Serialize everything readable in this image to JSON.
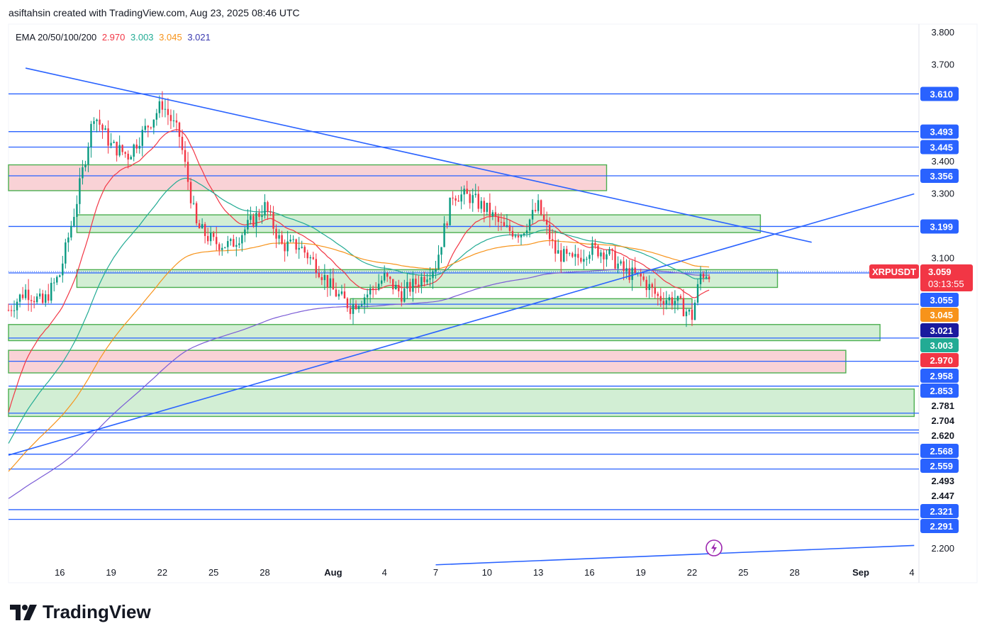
{
  "header": {
    "text": "asiftahsin created with TradingView.com, Aug 23, 2025 08:46 UTC"
  },
  "legend": {
    "label": "EMA 20/50/100/200",
    "values": [
      {
        "text": "2.970",
        "color": "#f23645"
      },
      {
        "text": "3.003",
        "color": "#22ab94"
      },
      {
        "text": "3.045",
        "color": "#f7931a"
      },
      {
        "text": "3.021",
        "color": "#3a3ab0"
      }
    ]
  },
  "symbol_tag": {
    "symbol": "XRPUSDT",
    "price": "3.059",
    "countdown": "03:13:55",
    "color": "#f23645"
  },
  "logo": {
    "text": "TradingView"
  },
  "colors": {
    "up": "#089981",
    "down": "#f23645",
    "level": "#2962ff",
    "supply": "#f8cdd2",
    "demand": "#cdeccf"
  },
  "chart_data": {
    "type": "candlestick",
    "y_range": [
      2.15,
      3.85
    ],
    "y_ticks": [
      {
        "value": 3.8,
        "label": "3.800"
      },
      {
        "value": 3.7,
        "label": "3.700"
      },
      {
        "value": 3.4,
        "label": "3.400"
      },
      {
        "value": 3.3,
        "label": "3.300"
      },
      {
        "value": 3.1,
        "label": "3.100"
      },
      {
        "value": 2.2,
        "label": "2.200"
      }
    ],
    "x_ticks": [
      "16",
      "19",
      "22",
      "25",
      "28",
      "Aug",
      "4",
      "7",
      "10",
      "13",
      "16",
      "19",
      "22",
      "25",
      "28",
      "Sep",
      "4"
    ],
    "price_levels": [
      {
        "value": 3.61,
        "label": "3.610",
        "color": "#2962ff"
      },
      {
        "value": 3.493,
        "label": "3.493",
        "color": "#2962ff"
      },
      {
        "value": 3.445,
        "label": "3.445",
        "color": "#2962ff"
      },
      {
        "value": 3.356,
        "label": "3.356",
        "color": "#2962ff"
      },
      {
        "value": 3.199,
        "label": "3.199",
        "color": "#2962ff"
      },
      {
        "value": 3.055,
        "label": "3.055",
        "color": "#2962ff"
      },
      {
        "value": 3.045,
        "label": "3.045",
        "color": "#f7931a"
      },
      {
        "value": 3.021,
        "label": "3.021",
        "color": "#1a1a9e"
      },
      {
        "value": 3.003,
        "label": "3.003",
        "color": "#22ab94"
      },
      {
        "value": 2.97,
        "label": "2.970",
        "color": "#f23645"
      },
      {
        "value": 2.958,
        "label": "2.958",
        "color": "#2962ff"
      },
      {
        "value": 2.853,
        "label": "2.853",
        "color": "#2962ff"
      },
      {
        "value": 2.781,
        "label": "2.781",
        "color": "#2962ff"
      },
      {
        "value": 2.704,
        "label": "2.704",
        "color": "#2962ff"
      },
      {
        "value": 2.62,
        "label": "2.620",
        "color": "#2962ff"
      },
      {
        "value": 2.568,
        "label": "2.568",
        "color": "#2962ff"
      },
      {
        "value": 2.559,
        "label": "2.559",
        "color": "#2962ff"
      },
      {
        "value": 2.493,
        "label": "2.493",
        "color": "#2962ff"
      },
      {
        "value": 2.447,
        "label": "2.447",
        "color": "#2962ff"
      },
      {
        "value": 2.321,
        "label": "2.321",
        "color": "#2962ff"
      },
      {
        "value": 2.291,
        "label": "2.291",
        "color": "#2962ff"
      }
    ],
    "zones": [
      {
        "type": "supply",
        "top": 3.39,
        "bottom": 3.31,
        "start": "Jul 13",
        "end": "Aug 17"
      },
      {
        "type": "demand",
        "top": 3.235,
        "bottom": 3.18,
        "start": "Jul 17",
        "end": "Aug 26"
      },
      {
        "type": "demand",
        "top": 3.065,
        "bottom": 3.01,
        "start": "Jul 17",
        "end": "Aug 27"
      },
      {
        "type": "demand",
        "top": 2.975,
        "bottom": 2.945,
        "start": "Aug 2",
        "end": "Aug 22"
      },
      {
        "type": "demand",
        "top": 2.895,
        "bottom": 2.845,
        "start": "Jul 13",
        "end": "Sep 2"
      },
      {
        "type": "supply",
        "top": 2.815,
        "bottom": 2.745,
        "start": "Jul 13",
        "end": "Aug 31"
      },
      {
        "type": "demand",
        "top": 2.695,
        "bottom": 2.61,
        "start": "Jul 13",
        "end": "Sep 4"
      }
    ],
    "trend_lines": [
      {
        "from": [
          "Jul 14",
          3.69
        ],
        "to": [
          "Aug 29",
          3.15
        ]
      },
      {
        "from": [
          "Jul 13",
          2.49
        ],
        "to": [
          "Sep 4",
          3.3
        ]
      },
      {
        "from": [
          "Aug 7",
          2.15
        ],
        "to": [
          "Sep 4",
          2.21
        ]
      }
    ],
    "ema_series": [
      {
        "name": "EMA 20",
        "period": 20,
        "color": "#f23645"
      },
      {
        "name": "EMA 50",
        "period": 50,
        "color": "#22ab94"
      },
      {
        "name": "EMA 100",
        "period": 100,
        "color": "#f7931a"
      },
      {
        "name": "EMA 200",
        "period": 200,
        "color": "#7a5bd6"
      }
    ],
    "candle_interval": "4h",
    "candles_start": "Jul 13",
    "close_path": [
      [
        "Jul 13",
        2.94
      ],
      [
        "Jul 14",
        3.0
      ],
      [
        "Jul 15",
        2.96
      ],
      [
        "Jul 16",
        3.05
      ],
      [
        "Jul 17",
        3.28
      ],
      [
        "Jul 18",
        3.55
      ],
      [
        "Jul 19",
        3.45
      ],
      [
        "Jul 20",
        3.42
      ],
      [
        "Jul 21",
        3.5
      ],
      [
        "Jul 22",
        3.58
      ],
      [
        "Jul 23",
        3.48
      ],
      [
        "Jul 24",
        3.2
      ],
      [
        "Jul 25",
        3.15
      ],
      [
        "Jul 26",
        3.14
      ],
      [
        "Jul 27",
        3.2
      ],
      [
        "Jul 28",
        3.26
      ],
      [
        "Jul 29",
        3.14
      ],
      [
        "Jul 30",
        3.14
      ],
      [
        "Jul 31",
        3.08
      ],
      [
        "Aug 1",
        3.0
      ],
      [
        "Aug 2",
        2.95
      ],
      [
        "Aug 3",
        2.99
      ],
      [
        "Aug 4",
        3.04
      ],
      [
        "Aug 5",
        2.99
      ],
      [
        "Aug 6",
        3.03
      ],
      [
        "Aug 7",
        3.08
      ],
      [
        "Aug 8",
        3.3
      ],
      [
        "Aug 9",
        3.29
      ],
      [
        "Aug 10",
        3.25
      ],
      [
        "Aug 11",
        3.19
      ],
      [
        "Aug 12",
        3.18
      ],
      [
        "Aug 13",
        3.26
      ],
      [
        "Aug 14",
        3.12
      ],
      [
        "Aug 15",
        3.09
      ],
      [
        "Aug 16",
        3.13
      ],
      [
        "Aug 17",
        3.12
      ],
      [
        "Aug 18",
        3.06
      ],
      [
        "Aug 19",
        3.04
      ],
      [
        "Aug 20",
        2.98
      ],
      [
        "Aug 21",
        2.97
      ],
      [
        "Aug 22",
        2.92
      ],
      [
        "Aug 22 12:00",
        3.05
      ],
      [
        "Aug 23",
        3.059
      ]
    ]
  }
}
